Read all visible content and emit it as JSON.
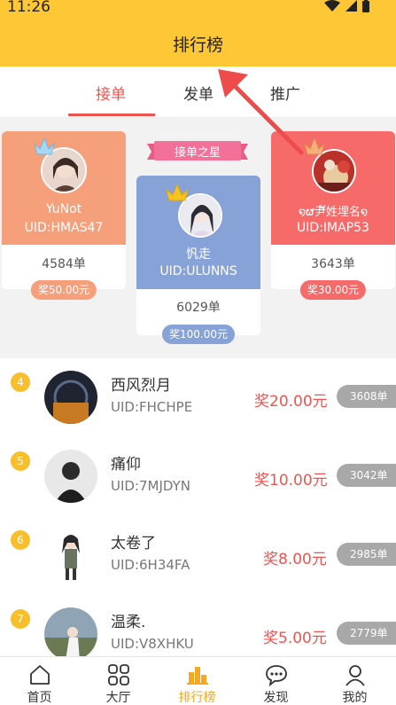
{
  "status_bar": {
    "time": "11:26"
  },
  "header": {
    "title": "排行榜"
  },
  "tabs": [
    {
      "label": "接单",
      "active": true
    },
    {
      "label": "发单",
      "active": false
    },
    {
      "label": "推广",
      "active": false
    }
  ],
  "podium": {
    "banner": "接单之星",
    "first": {
      "name": "忛走",
      "uid": "UID:ULUNNS",
      "count": "6029单",
      "prize": "奖100.00元"
    },
    "second": {
      "name": "YuNot",
      "uid": "UID:HMAS47",
      "count": "4584单",
      "prize": "奖50.00元"
    },
    "third": {
      "name": "໑ຜ尹້姓埋名໑",
      "uid": "UID:IMAP53",
      "count": "3643单",
      "prize": "奖30.00元"
    }
  },
  "ranking": [
    {
      "rank": "4",
      "name": "西风烈月",
      "uid": "UID:FHCHPE",
      "prize": "奖20.00元",
      "count": "3608单"
    },
    {
      "rank": "5",
      "name": "痛仰",
      "uid": "UID:7MJDYN",
      "prize": "奖10.00元",
      "count": "3042单"
    },
    {
      "rank": "6",
      "name": "太卷了",
      "uid": "UID:6H34FA",
      "prize": "奖8.00元",
      "count": "2985单"
    },
    {
      "rank": "7",
      "name": "温柔.",
      "uid": "UID:V8XHKU",
      "prize": "奖5.00元",
      "count": "2779单"
    }
  ],
  "bottom_nav": [
    {
      "label": "首页",
      "icon": "home-icon",
      "active": false
    },
    {
      "label": "大厅",
      "icon": "grid-icon",
      "active": false
    },
    {
      "label": "排行榜",
      "icon": "ranking-icon",
      "active": true
    },
    {
      "label": "发现",
      "icon": "chat-bubble-icon",
      "active": false
    },
    {
      "label": "我的",
      "icon": "user-icon",
      "active": false
    }
  ],
  "colors": {
    "header": "#fdc735",
    "accent": "#f0534f",
    "second_card": "#f59f7b",
    "first_card": "#86a2d6",
    "third_card": "#f66a6a",
    "rank_badge": "#f8be2c",
    "nav_active": "#f5a623"
  }
}
